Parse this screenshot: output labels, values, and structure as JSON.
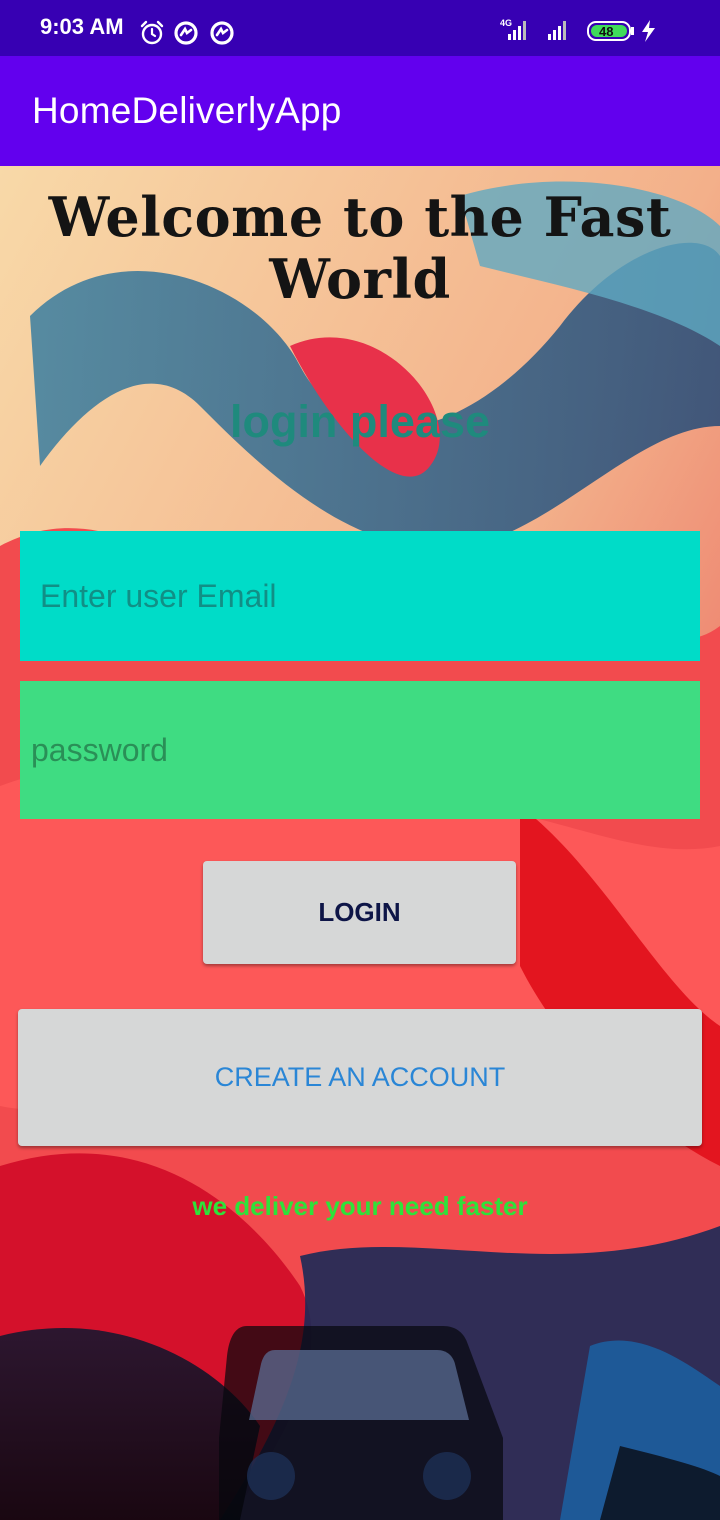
{
  "status_bar": {
    "time": "9:03 AM",
    "network_label": "4G",
    "battery": "48",
    "icons": [
      "alarm-icon",
      "data-saver-icon",
      "data-saver-icon",
      "signal-icon",
      "signal-icon",
      "battery-icon",
      "charging-icon"
    ]
  },
  "app_bar": {
    "title": "HomeDeliverlyApp"
  },
  "main": {
    "welcome_title": "Welcome to the Fast World",
    "subtitle": "login please",
    "email_placeholder": "Enter user Email",
    "password_placeholder": "password",
    "login_button": "LOGIN",
    "create_account_button": "CREATE AN ACCOUNT",
    "tagline": "we deliver your need faster",
    "decor_icon": "car-icon"
  },
  "colors": {
    "status_bar": "#3700b3",
    "app_bar": "#6200ee",
    "email_field": "#00dcc8",
    "password_field": "#3fdc82",
    "button_bg": "#d6d7d7",
    "login_text": "#0e1547",
    "create_text": "#2a86d6",
    "subtitle": "#1f8a7d",
    "tagline": "#2ee23a"
  }
}
